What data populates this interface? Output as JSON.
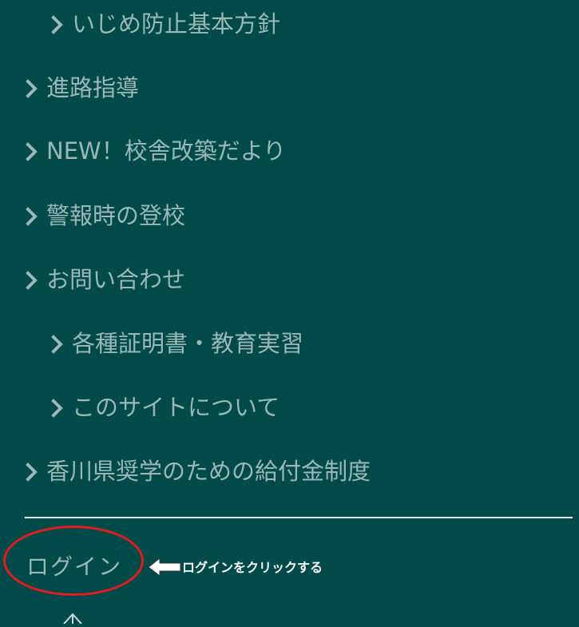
{
  "menu": {
    "items": [
      {
        "label": "いじめ防止基本方針"
      },
      {
        "label": "進路指導"
      },
      {
        "label": "NEW！校舎改築だより"
      },
      {
        "label": "警報時の登校"
      },
      {
        "label": "お問い合わせ"
      },
      {
        "label": "各種証明書・教育実習"
      },
      {
        "label": "このサイトについて"
      },
      {
        "label": "香川県奨学のための給付金制度"
      }
    ]
  },
  "login": {
    "label": "ログイン"
  },
  "annotation": {
    "text": "ログインをクリックする",
    "highlight_color": "#e31d1d"
  },
  "colors": {
    "background": "#004a4a",
    "menu_text": "#9ab8b4",
    "divider": "#e6efee"
  },
  "icons": {
    "menu_bullet": "chevron-right-icon",
    "pointer": "arrow-left-icon"
  }
}
